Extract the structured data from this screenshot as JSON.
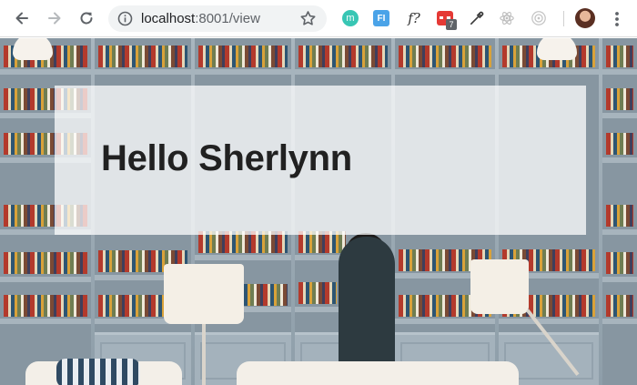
{
  "browser": {
    "url_host": "localhost",
    "url_rest": ":8001/view",
    "extensions": {
      "mint_letter": "m",
      "fi_label": "FI",
      "fq_label": "f?",
      "red_badge": "7"
    }
  },
  "page": {
    "greeting": "Hello Sherlynn"
  },
  "colors": {
    "overlay": "rgba(255,255,255,0.74)",
    "text": "#212121",
    "toolbar_icon": "#5f6368"
  }
}
